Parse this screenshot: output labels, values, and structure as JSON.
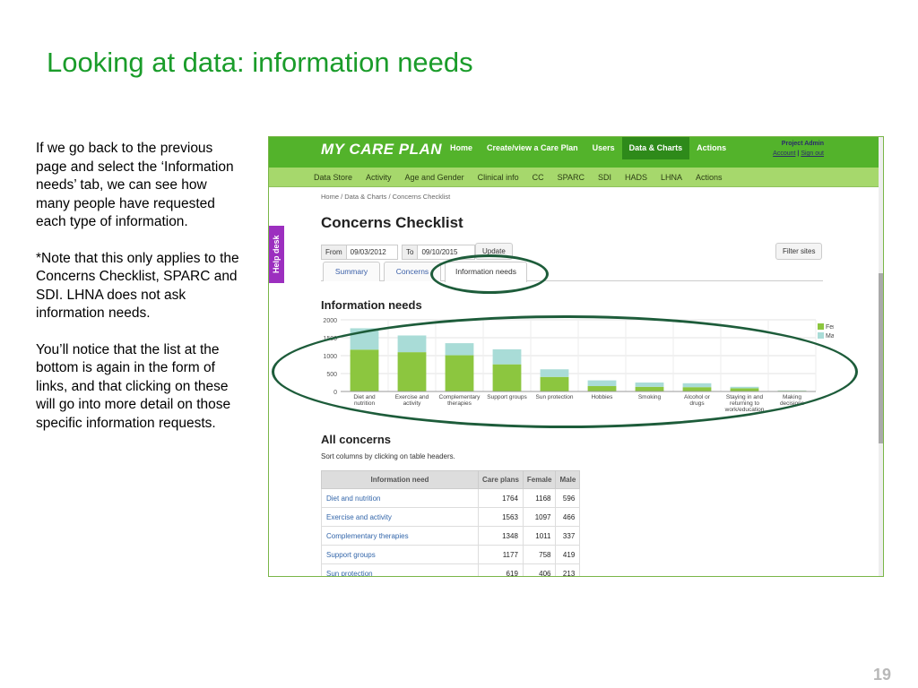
{
  "slide": {
    "title": "Looking at data: information needs",
    "page_number": "19",
    "notes": [
      "If we go back to the previous page and select the ‘Information needs’ tab, we can see how many people have requested each type of information.",
      "*Note that this only applies to the Concerns Checklist, SPARC and SDI. LHNA does not ask information needs.",
      "You’ll notice that the list at the bottom is again in the form of links, and that clicking on these will go into more detail on those specific information requests."
    ]
  },
  "app": {
    "logo": "MY CARE PLAN",
    "main_nav": [
      "Home",
      "Create/view a Care Plan",
      "Users",
      "Data & Charts",
      "Actions"
    ],
    "main_nav_active": "Data & Charts",
    "admin": {
      "name": "Project Admin",
      "account": "Account",
      "sign_out": "Sign out"
    },
    "sub_nav": [
      "Data Store",
      "Activity",
      "Age and Gender",
      "Clinical info",
      "CC",
      "SPARC",
      "SDI",
      "HADS",
      "LHNA",
      "Actions"
    ],
    "breadcrumb": "Home / Data & Charts / Concerns Checklist",
    "page_title": "Concerns Checklist",
    "filter": {
      "from_label": "From",
      "from_value": "09/03/2012",
      "to_label": "To",
      "to_value": "09/10/2015",
      "update_button": "Update",
      "filter_sites_button": "Filter sites"
    },
    "tabs": [
      "Summary",
      "Concerns",
      "Information needs"
    ],
    "active_tab": "Information needs",
    "help_desk": "Help desk",
    "section_title": "Information needs",
    "all_title": "All concerns",
    "sort_hint": "Sort columns by clicking on table headers.",
    "table": {
      "headers": [
        "Information need",
        "Care plans",
        "Female",
        "Male"
      ],
      "rows": [
        [
          "Diet and nutrition",
          "1764",
          "1168",
          "596"
        ],
        [
          "Exercise and activity",
          "1563",
          "1097",
          "466"
        ],
        [
          "Complementary therapies",
          "1348",
          "1011",
          "337"
        ],
        [
          "Support groups",
          "1177",
          "758",
          "419"
        ],
        [
          "Sun protection",
          "619",
          "406",
          "213"
        ]
      ]
    }
  },
  "chart_data": {
    "type": "bar",
    "stacked": true,
    "categories": [
      "Diet and nutrition",
      "Exercise and activity",
      "Complementary therapies",
      "Support groups",
      "Sun protection",
      "Hobbies",
      "Smoking",
      "Alcohol or drugs",
      "Staying in and returning to work/education",
      "Making decisions"
    ],
    "series": [
      {
        "name": "Female",
        "color": "#8cc63f",
        "values": [
          1168,
          1097,
          1011,
          758,
          406,
          150,
          130,
          120,
          90,
          20
        ]
      },
      {
        "name": "Male",
        "color": "#a9dcd7",
        "values": [
          596,
          466,
          337,
          419,
          213,
          160,
          120,
          110,
          40,
          10
        ]
      }
    ],
    "ylim": [
      0,
      2000
    ],
    "yticks": [
      "0",
      "500",
      "1000",
      "1500",
      "2000"
    ],
    "legend": "top-right",
    "grid": true
  }
}
